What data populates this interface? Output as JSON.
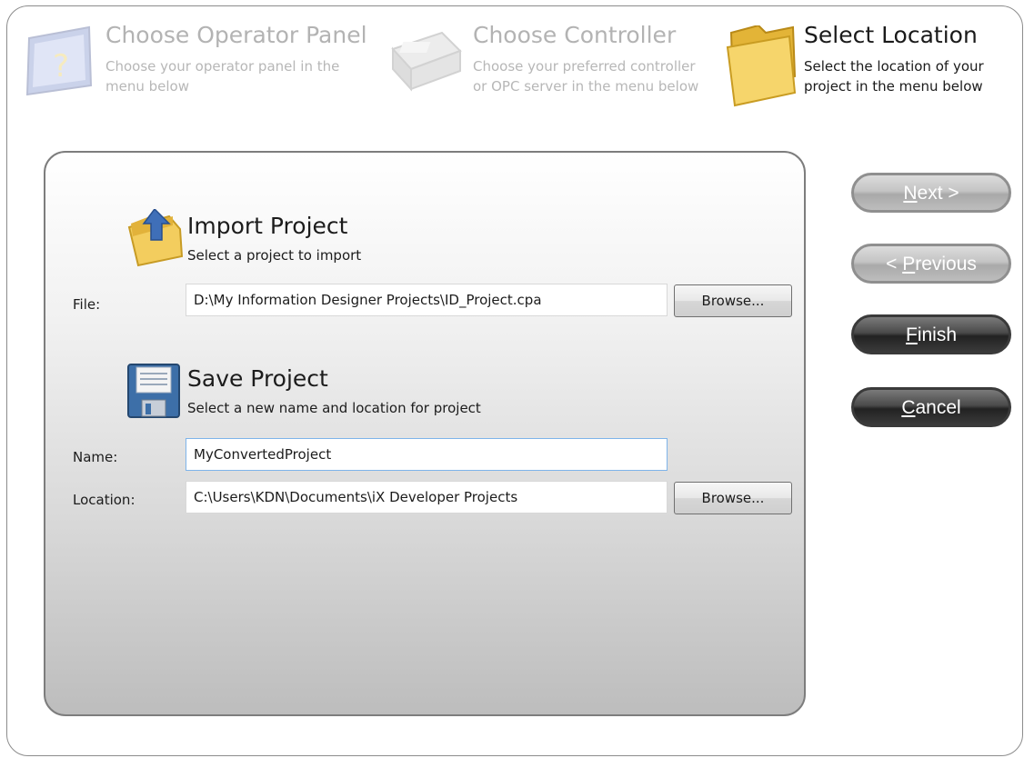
{
  "wizard_steps": [
    {
      "title": "Choose Operator Panel",
      "desc": "Choose your operator panel in the\nmenu below",
      "icon": "operator-panel-icon"
    },
    {
      "title": "Choose Controller",
      "desc": "Choose your preferred controller\nor OPC server in the menu below",
      "icon": "controller-icon"
    },
    {
      "title": "Select Location",
      "desc": "Select the location of your\nproject in the menu below",
      "icon": "folder-icon"
    }
  ],
  "import": {
    "title": "Import Project",
    "desc": "Select a project to import",
    "file_label": "File:",
    "file_value": "D:\\My Information Designer Projects\\ID_Project.cpa",
    "browse_label": "Browse..."
  },
  "save": {
    "title": "Save Project",
    "desc": "Select a new name and location for project",
    "name_label": "Name:",
    "name_value": "MyConvertedProject",
    "location_label": "Location:",
    "location_value": "C:\\Users\\KDN\\Documents\\iX Developer Projects",
    "browse_label": "Browse..."
  },
  "nav": {
    "next": {
      "mnemonic": "N",
      "rest": "ext >"
    },
    "previous": {
      "pre": "< ",
      "mnemonic": "P",
      "rest": "revious"
    },
    "finish": {
      "mnemonic": "F",
      "rest": "inish"
    },
    "cancel": {
      "mnemonic": "C",
      "rest": "ancel"
    }
  },
  "colors": {
    "accent_focus": "#7eb4ea",
    "folder": "#f2c94c"
  }
}
